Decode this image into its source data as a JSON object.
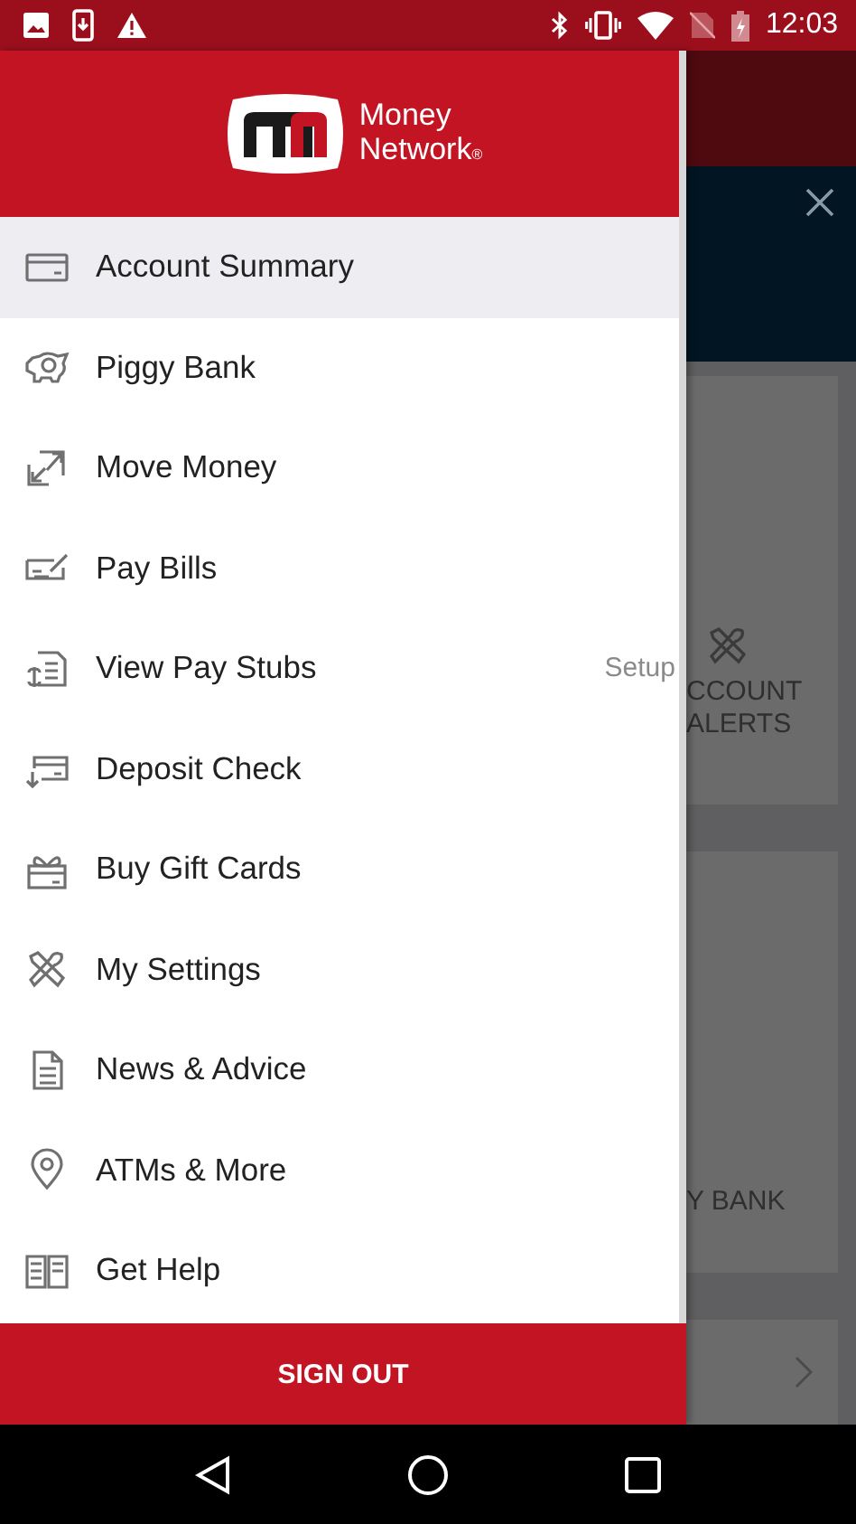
{
  "status_bar": {
    "time": "12:03"
  },
  "logo": {
    "line_1": "Money",
    "line_2": "Network",
    "mark": "®"
  },
  "menu": [
    {
      "label": "Account Summary",
      "selected": true
    },
    {
      "label": "Piggy Bank",
      "selected": false
    },
    {
      "label": "Move Money",
      "selected": false
    },
    {
      "label": "Pay Bills",
      "selected": false
    },
    {
      "label": "View Pay Stubs",
      "selected": false,
      "trailing": "Setup"
    },
    {
      "label": "Deposit Check",
      "selected": false
    },
    {
      "label": "Buy Gift Cards",
      "selected": false
    },
    {
      "label": "My Settings",
      "selected": false
    },
    {
      "label": "News & Advice",
      "selected": false
    },
    {
      "label": "ATMs & More",
      "selected": false
    },
    {
      "label": "Get Help",
      "selected": false
    }
  ],
  "sign_out": "SIGN OUT",
  "background": {
    "cards": [
      {
        "line_1": "CCOUNT",
        "line_2": "ALERTS"
      },
      {
        "line_1": "Y BANK"
      }
    ]
  }
}
